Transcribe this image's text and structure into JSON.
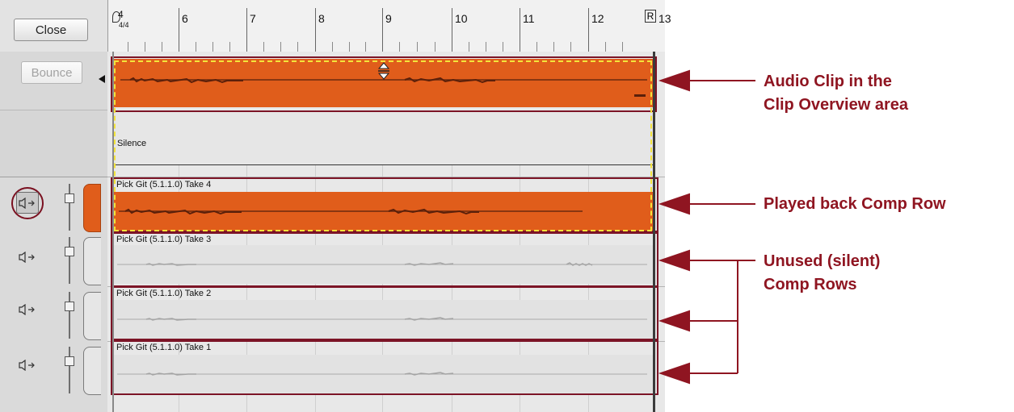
{
  "toolbar": {
    "close_label": "Close",
    "bounce_label": "Bounce"
  },
  "ruler": {
    "meter_top": "4",
    "meter_bottom": "4/4",
    "marks": [
      "6",
      "7",
      "8",
      "9",
      "10",
      "11",
      "12",
      "13"
    ],
    "left_locator": "L",
    "right_locator": "R"
  },
  "lanes": {
    "silence_label": "Silence",
    "comp_rows": [
      {
        "label": "Pick Git (5.1.1.0) Take 4",
        "state": "played"
      },
      {
        "label": "Pick Git (5.1.1.0) Take 3",
        "state": "unused"
      },
      {
        "label": "Pick Git (5.1.1.0) Take 2",
        "state": "unused"
      },
      {
        "label": "Pick Git (5.1.1.0) Take 1",
        "state": "unused"
      }
    ]
  },
  "annotations": {
    "overview_line1": "Audio Clip in the",
    "overview_line2": "Clip Overview area",
    "played_row": "Played back Comp Row",
    "unused_line1": "Unused (silent)",
    "unused_line2": "Comp Rows"
  },
  "colors": {
    "clip_orange": "#e05d1b",
    "annotation_red": "#8f1521",
    "dash_yellow": "#f3e43a"
  },
  "icons": [
    "speaker-icon",
    "fader-icon",
    "loop-locator-icon"
  ]
}
